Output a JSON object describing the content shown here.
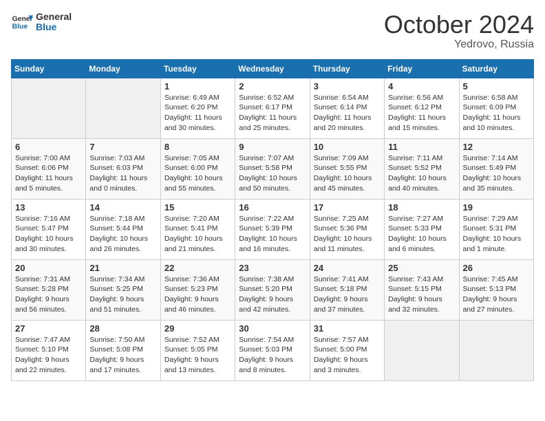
{
  "header": {
    "logo_general": "General",
    "logo_blue": "Blue",
    "month": "October 2024",
    "location": "Yedrovo, Russia"
  },
  "weekdays": [
    "Sunday",
    "Monday",
    "Tuesday",
    "Wednesday",
    "Thursday",
    "Friday",
    "Saturday"
  ],
  "weeks": [
    [
      {
        "day": "",
        "detail": ""
      },
      {
        "day": "",
        "detail": ""
      },
      {
        "day": "1",
        "detail": "Sunrise: 6:49 AM\nSunset: 6:20 PM\nDaylight: 11 hours and 30 minutes."
      },
      {
        "day": "2",
        "detail": "Sunrise: 6:52 AM\nSunset: 6:17 PM\nDaylight: 11 hours and 25 minutes."
      },
      {
        "day": "3",
        "detail": "Sunrise: 6:54 AM\nSunset: 6:14 PM\nDaylight: 11 hours and 20 minutes."
      },
      {
        "day": "4",
        "detail": "Sunrise: 6:56 AM\nSunset: 6:12 PM\nDaylight: 11 hours and 15 minutes."
      },
      {
        "day": "5",
        "detail": "Sunrise: 6:58 AM\nSunset: 6:09 PM\nDaylight: 11 hours and 10 minutes."
      }
    ],
    [
      {
        "day": "6",
        "detail": "Sunrise: 7:00 AM\nSunset: 6:06 PM\nDaylight: 11 hours and 5 minutes."
      },
      {
        "day": "7",
        "detail": "Sunrise: 7:03 AM\nSunset: 6:03 PM\nDaylight: 11 hours and 0 minutes."
      },
      {
        "day": "8",
        "detail": "Sunrise: 7:05 AM\nSunset: 6:00 PM\nDaylight: 10 hours and 55 minutes."
      },
      {
        "day": "9",
        "detail": "Sunrise: 7:07 AM\nSunset: 5:58 PM\nDaylight: 10 hours and 50 minutes."
      },
      {
        "day": "10",
        "detail": "Sunrise: 7:09 AM\nSunset: 5:55 PM\nDaylight: 10 hours and 45 minutes."
      },
      {
        "day": "11",
        "detail": "Sunrise: 7:11 AM\nSunset: 5:52 PM\nDaylight: 10 hours and 40 minutes."
      },
      {
        "day": "12",
        "detail": "Sunrise: 7:14 AM\nSunset: 5:49 PM\nDaylight: 10 hours and 35 minutes."
      }
    ],
    [
      {
        "day": "13",
        "detail": "Sunrise: 7:16 AM\nSunset: 5:47 PM\nDaylight: 10 hours and 30 minutes."
      },
      {
        "day": "14",
        "detail": "Sunrise: 7:18 AM\nSunset: 5:44 PM\nDaylight: 10 hours and 26 minutes."
      },
      {
        "day": "15",
        "detail": "Sunrise: 7:20 AM\nSunset: 5:41 PM\nDaylight: 10 hours and 21 minutes."
      },
      {
        "day": "16",
        "detail": "Sunrise: 7:22 AM\nSunset: 5:39 PM\nDaylight: 10 hours and 16 minutes."
      },
      {
        "day": "17",
        "detail": "Sunrise: 7:25 AM\nSunset: 5:36 PM\nDaylight: 10 hours and 11 minutes."
      },
      {
        "day": "18",
        "detail": "Sunrise: 7:27 AM\nSunset: 5:33 PM\nDaylight: 10 hours and 6 minutes."
      },
      {
        "day": "19",
        "detail": "Sunrise: 7:29 AM\nSunset: 5:31 PM\nDaylight: 10 hours and 1 minute."
      }
    ],
    [
      {
        "day": "20",
        "detail": "Sunrise: 7:31 AM\nSunset: 5:28 PM\nDaylight: 9 hours and 56 minutes."
      },
      {
        "day": "21",
        "detail": "Sunrise: 7:34 AM\nSunset: 5:25 PM\nDaylight: 9 hours and 51 minutes."
      },
      {
        "day": "22",
        "detail": "Sunrise: 7:36 AM\nSunset: 5:23 PM\nDaylight: 9 hours and 46 minutes."
      },
      {
        "day": "23",
        "detail": "Sunrise: 7:38 AM\nSunset: 5:20 PM\nDaylight: 9 hours and 42 minutes."
      },
      {
        "day": "24",
        "detail": "Sunrise: 7:41 AM\nSunset: 5:18 PM\nDaylight: 9 hours and 37 minutes."
      },
      {
        "day": "25",
        "detail": "Sunrise: 7:43 AM\nSunset: 5:15 PM\nDaylight: 9 hours and 32 minutes."
      },
      {
        "day": "26",
        "detail": "Sunrise: 7:45 AM\nSunset: 5:13 PM\nDaylight: 9 hours and 27 minutes."
      }
    ],
    [
      {
        "day": "27",
        "detail": "Sunrise: 7:47 AM\nSunset: 5:10 PM\nDaylight: 9 hours and 22 minutes."
      },
      {
        "day": "28",
        "detail": "Sunrise: 7:50 AM\nSunset: 5:08 PM\nDaylight: 9 hours and 17 minutes."
      },
      {
        "day": "29",
        "detail": "Sunrise: 7:52 AM\nSunset: 5:05 PM\nDaylight: 9 hours and 13 minutes."
      },
      {
        "day": "30",
        "detail": "Sunrise: 7:54 AM\nSunset: 5:03 PM\nDaylight: 9 hours and 8 minutes."
      },
      {
        "day": "31",
        "detail": "Sunrise: 7:57 AM\nSunset: 5:00 PM\nDaylight: 9 hours and 3 minutes."
      },
      {
        "day": "",
        "detail": ""
      },
      {
        "day": "",
        "detail": ""
      }
    ]
  ]
}
